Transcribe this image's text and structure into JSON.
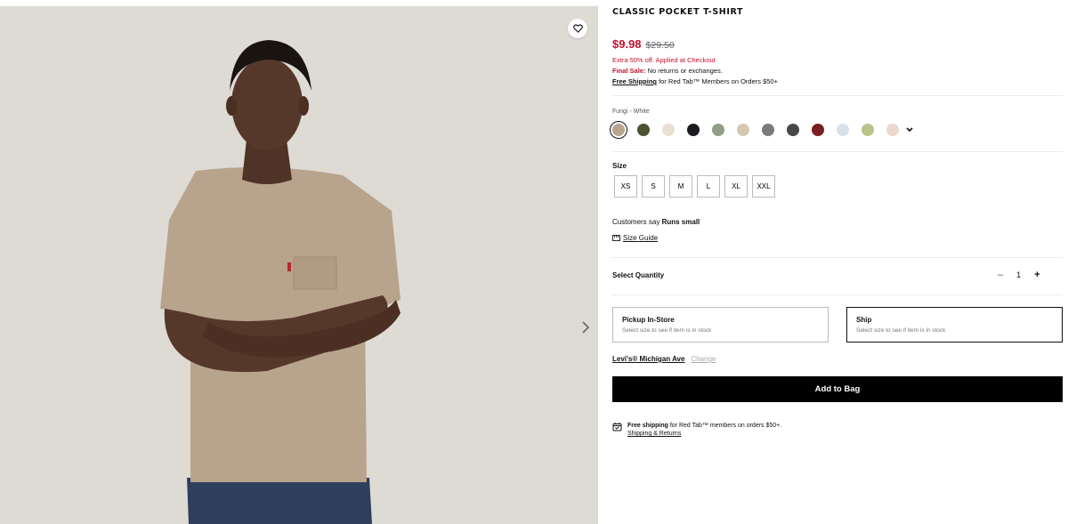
{
  "product": {
    "title": "CLASSIC POCKET T-SHIRT",
    "sale_price": "$9.98",
    "original_price": "$29.50",
    "promo": "Extra 50% off. Applied at Checkout",
    "final_sale_label": "Final Sale:",
    "final_sale_text": " No returns or exchanges.",
    "free_shipping_label": "Free Shipping",
    "free_shipping_text": " for Red Tab™ Members on Orders $50+"
  },
  "color": {
    "selected_name": "Fungi - White",
    "swatches": [
      {
        "name": "fungi-white",
        "hex": "#b9a48f",
        "selected": true
      },
      {
        "name": "olive",
        "hex": "#4a5233"
      },
      {
        "name": "cream",
        "hex": "#e9e1cf"
      },
      {
        "name": "black",
        "hex": "#1b1b1f"
      },
      {
        "name": "sage",
        "hex": "#8f9f86"
      },
      {
        "name": "sand",
        "hex": "#d5c7b3"
      },
      {
        "name": "grey",
        "hex": "#7c7a77"
      },
      {
        "name": "charcoal",
        "hex": "#48484a"
      },
      {
        "name": "burgundy",
        "hex": "#7b1e22"
      },
      {
        "name": "light-blue",
        "hex": "#d8e2ea"
      },
      {
        "name": "light-olive",
        "hex": "#bcc389"
      },
      {
        "name": "blush",
        "hex": "#ecd8cc"
      }
    ]
  },
  "size": {
    "label": "Size",
    "options": [
      "XS",
      "S",
      "M",
      "L",
      "XL",
      "XXL"
    ],
    "fit_prefix": "Customers say ",
    "fit_value": "Runs small",
    "guide_label": "Size Guide"
  },
  "quantity": {
    "label": "Select Quantity",
    "minus": "–",
    "value": "1",
    "plus": "+"
  },
  "fulfillment": {
    "pickup_title": "Pickup In-Store",
    "pickup_sub": "Select size to see if item is in stock",
    "ship_title": "Ship",
    "ship_sub": "Select size to see if item is in stock"
  },
  "store": {
    "name": "Levi's® Michigan Ave",
    "change": "Change"
  },
  "add_to_bag": "Add to Bag",
  "shipping_note": {
    "bold": "Free shipping",
    "text": " for Red Tab™ members on orders $50+.",
    "link": "Shipping & Returns"
  },
  "colors": {
    "sale_red": "#c41230",
    "button_black": "#000000"
  }
}
